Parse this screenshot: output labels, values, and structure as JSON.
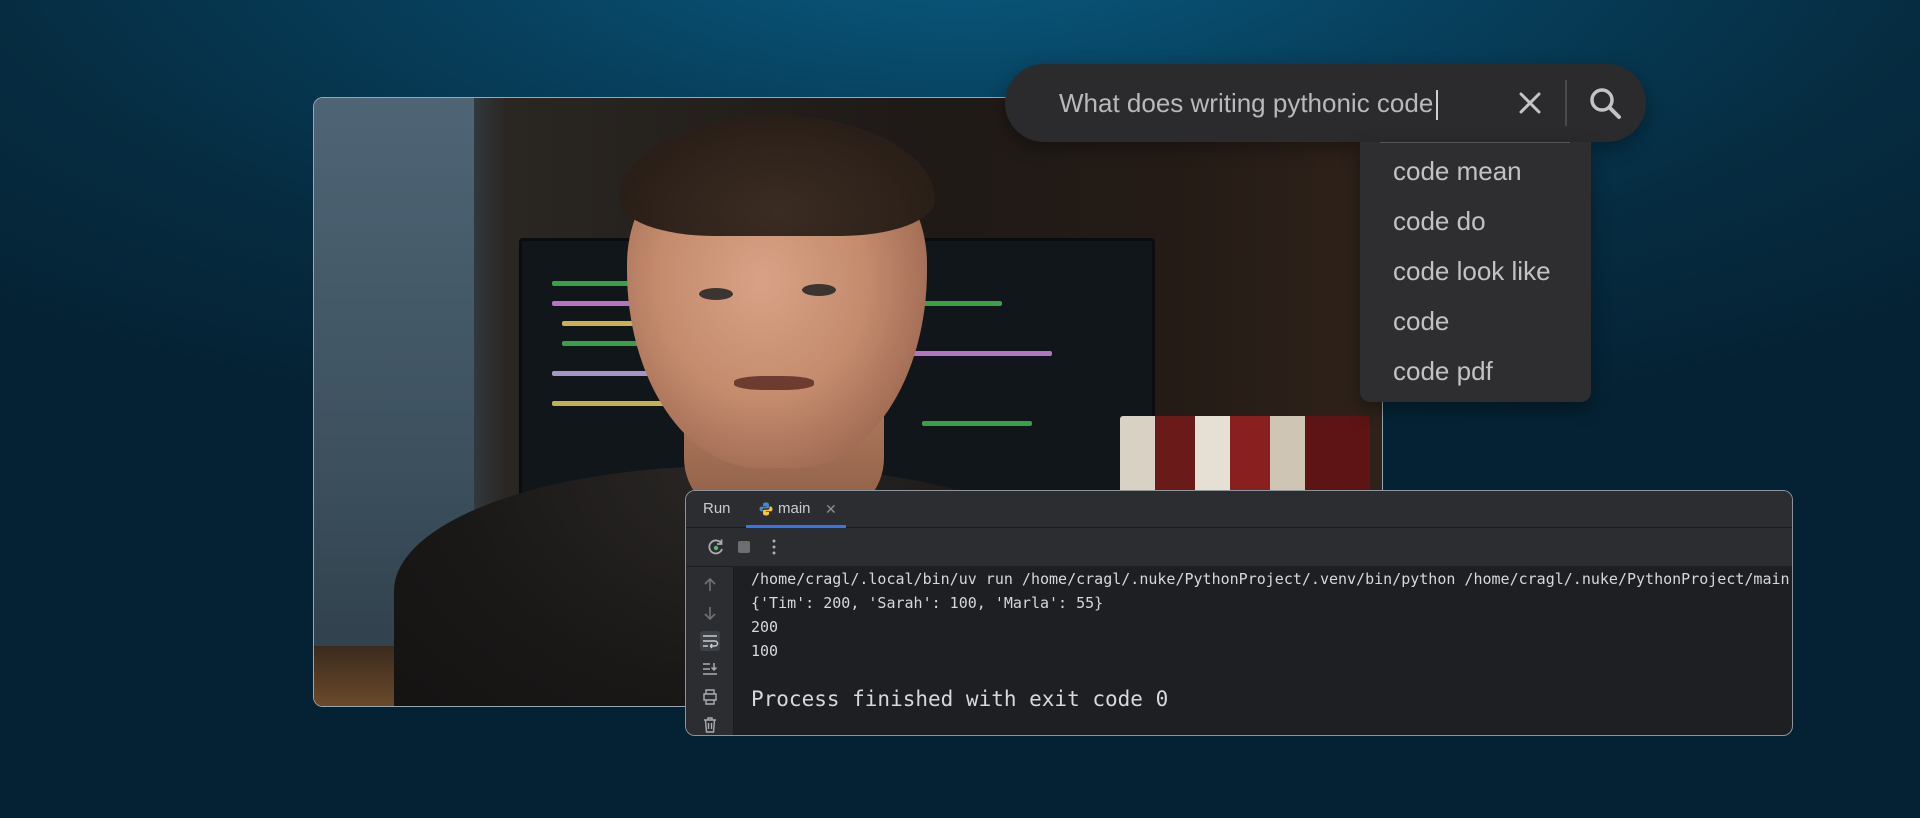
{
  "search": {
    "query": "What does writing pythonic code",
    "suggestions": [
      "code mean",
      "code do",
      "code look like",
      "code",
      "code pdf"
    ]
  },
  "run_panel": {
    "tabs": {
      "run": "Run",
      "main": "main"
    },
    "console": {
      "command": "/home/cragl/.local/bin/uv run /home/cragl/.nuke/PythonProject/.venv/bin/python /home/cragl/.nuke/PythonProject/main.py",
      "output": [
        "{'Tim': 200, 'Sarah': 100, 'Marla': 55}",
        "200",
        "100"
      ],
      "exit_message": "Process finished with exit code 0"
    }
  },
  "colors": {
    "background": "#062c41",
    "search_bg": "#2b2b2d",
    "panel_bg": "#1e1f22",
    "tab_accent": "#3574f0"
  },
  "icons": [
    "close-icon",
    "search-icon",
    "python-icon",
    "rerun-icon",
    "stop-icon",
    "more-icon",
    "arrow-up-icon",
    "arrow-down-icon",
    "soft-wrap-icon",
    "scroll-to-end-icon",
    "print-icon",
    "trash-icon"
  ]
}
